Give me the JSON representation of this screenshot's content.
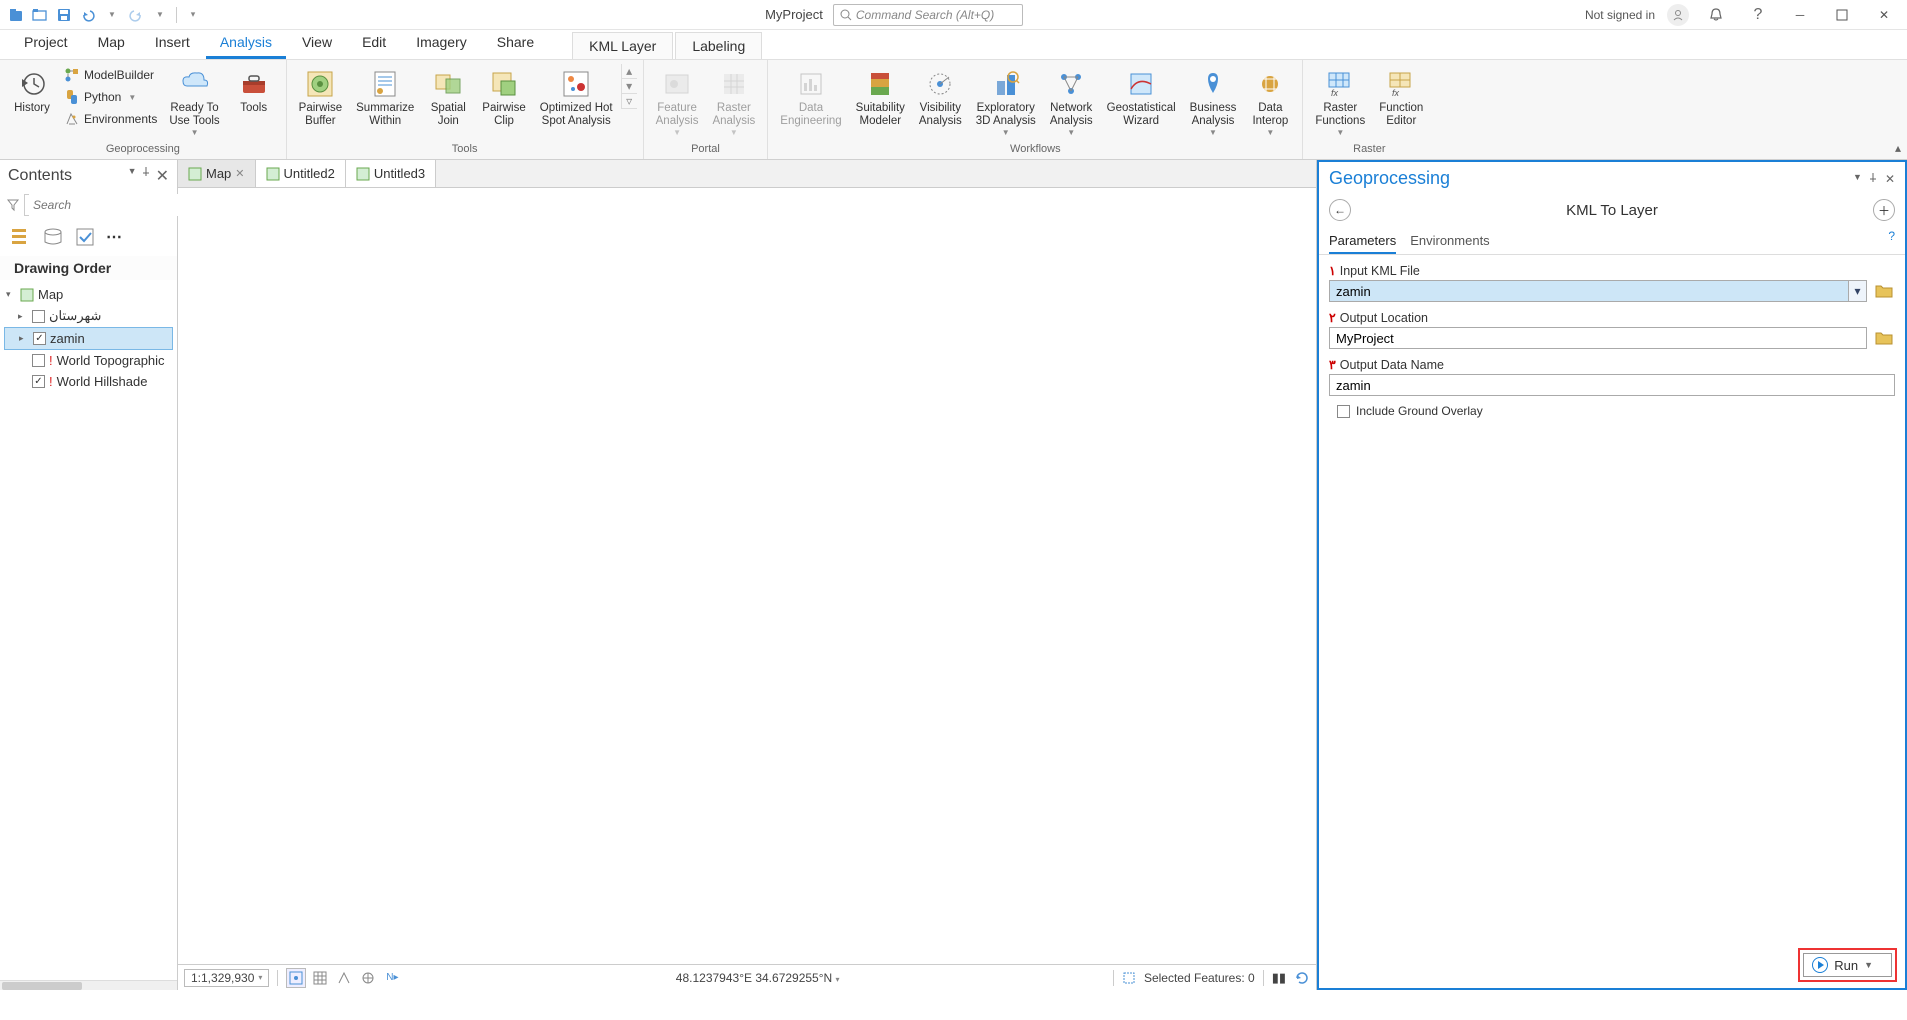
{
  "titlebar": {
    "project_name": "MyProject",
    "command_search_placeholder": "Command Search (Alt+Q)",
    "not_signed_in": "Not signed in"
  },
  "tabs": {
    "project": "Project",
    "map": "Map",
    "insert": "Insert",
    "analysis": "Analysis",
    "view": "View",
    "edit": "Edit",
    "imagery": "Imagery",
    "share": "Share",
    "kml_layer": "KML Layer",
    "labeling": "Labeling"
  },
  "ribbon": {
    "history": "History",
    "modelbuilder": "ModelBuilder",
    "python": "Python",
    "environments": "Environments",
    "ready_to_use_tools": "Ready To\nUse Tools",
    "tools": "Tools",
    "group_geoprocessing": "Geoprocessing",
    "pairwise_buffer": "Pairwise\nBuffer",
    "summarize_within": "Summarize\nWithin",
    "spatial_join": "Spatial\nJoin",
    "pairwise_clip": "Pairwise\nClip",
    "optimized_hot_spot": "Optimized Hot\nSpot Analysis",
    "group_tools": "Tools",
    "feature_analysis": "Feature\nAnalysis",
    "raster_analysis": "Raster\nAnalysis",
    "group_portal": "Portal",
    "data_engineering": "Data\nEngineering",
    "suitability_modeler": "Suitability\nModeler",
    "visibility_analysis": "Visibility\nAnalysis",
    "exploratory_3d": "Exploratory\n3D Analysis",
    "network_analysis": "Network\nAnalysis",
    "geostatistical_wizard": "Geostatistical\nWizard",
    "business_analysis": "Business\nAnalysis",
    "data_interop": "Data\nInterop",
    "group_workflows": "Workflows",
    "raster_functions": "Raster\nFunctions",
    "function_editor": "Function\nEditor",
    "group_raster": "Raster"
  },
  "contents": {
    "title": "Contents",
    "search_placeholder": "Search",
    "drawing_order": "Drawing Order",
    "map_label": "Map",
    "layer_shahrestan": "شهرستان",
    "layer_zamin": "zamin",
    "layer_topo": "World Topographic",
    "layer_hillshade": "World Hillshade"
  },
  "map_tabs": {
    "map": "Map",
    "untitled2": "Untitled2",
    "untitled3": "Untitled3"
  },
  "statusbar": {
    "scale": "1:1,329,930",
    "coords": "48.1237943°E 34.6729255°N",
    "selected": "Selected Features: 0"
  },
  "gp": {
    "pane_title": "Geoprocessing",
    "tool_title": "KML To Layer",
    "tab_parameters": "Parameters",
    "tab_environments": "Environments",
    "p1_label": "Input KML File",
    "p1_value": "zamin",
    "p2_label": "Output Location",
    "p2_value": "MyProject",
    "p3_label": "Output Data Name",
    "p3_value": "zamin",
    "p4_label": "Include Ground Overlay",
    "run": "Run"
  }
}
